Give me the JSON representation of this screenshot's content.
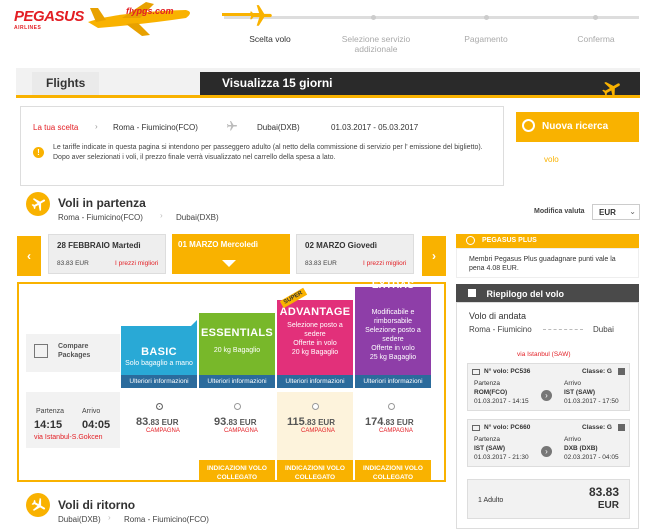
{
  "brand": {
    "logo": "PEGASUS",
    "logo_sub": "AIRLINES",
    "plane_text": "flypgs.com"
  },
  "steps": [
    {
      "label": "Scelta volo"
    },
    {
      "label": "Selezione servizio\naddizionale"
    },
    {
      "label": "Pagamento"
    },
    {
      "label": "Conferma"
    }
  ],
  "tabs": {
    "flights": "Flights",
    "view15": "Visualizza 15 giorni"
  },
  "choice": {
    "label": "La tua scelta",
    "from": "Roma - Fiumicino(FCO)",
    "to": "Dubai(DXB)",
    "dates": "01.03.2017 - 05.03.2017",
    "notice": "Le tariffe indicate in questa pagina si intendono per passeggero adulto (al netto della commissione di servizio per l' emissione del biglietto). Dopo aver selezionati i voli, il prezzo finale verrà visualizzato nel carrello della spesa a lato.",
    "new_search": "Nuova ricerca",
    "new_search_sub": "volo"
  },
  "outbound": {
    "title": "Voli in partenza",
    "route_from": "Roma - Fiumicino(FCO)",
    "route_to": "Dubai(DXB)",
    "currency_label": "Modifica valuta",
    "currency": "EUR"
  },
  "days": [
    {
      "title": "28 FEBBRAIO Martedì",
      "price": "83.83 EUR",
      "link": "I prezzi migliori"
    },
    {
      "title": "01 MARZO Mercoledì"
    },
    {
      "title": "02 MARZO Giovedì",
      "price": "83.83 EUR",
      "link": "I prezzi migliori"
    }
  ],
  "compare": {
    "label": "Compare\nPackages"
  },
  "fares": [
    {
      "name": "BASIC",
      "desc": "Solo bagaglio a mano",
      "more": "Ulteriori informazioni",
      "price_int": "83",
      "price_dec": ".83 EUR",
      "campaign": "CAMPAGNA",
      "connect": "",
      "color": "#29a9d6"
    },
    {
      "name": "ESSENTIALS",
      "desc": "20 kg Bagaglio",
      "more": "Ulteriori informazioni",
      "price_int": "93",
      "price_dec": ".83 EUR",
      "campaign": "CAMPAGNA",
      "connect": "INDICAZIONI VOLO\nCOLLEGATO",
      "color": "#78b82a"
    },
    {
      "name": "ADVANTAGE",
      "desc": "Selezione posto a sedere\nOfferte in volo\n20 kg Bagaglio",
      "more": "Ulteriori informazioni",
      "price_int": "115",
      "price_dec": ".83 EUR",
      "campaign": "CAMPAGNA",
      "connect": "INDICAZIONI VOLO\nCOLLEGATO",
      "color": "#e2307a",
      "badge": "SUPER"
    },
    {
      "name": "EXTRAS",
      "desc": "Modificabile e rimborsabile\nSelezione posto a sedere\nOfferte in volo\n25 kg Bagaglio",
      "more": "Ulteriori informazioni",
      "price_int": "174",
      "price_dec": ".83 EUR",
      "campaign": "CAMPAGNA",
      "connect": "INDICAZIONI VOLO\nCOLLEGATO",
      "color": "#8e3ea8"
    }
  ],
  "flight": {
    "dep_label": "Partenza",
    "arr_label": "Arrivo",
    "dep_time": "14:15",
    "arr_time": "04:05",
    "via": "via Istanbul-S.Gokcen"
  },
  "return": {
    "title": "Voli di ritorno",
    "route_from": "Dubai(DXB)",
    "route_to": "Roma - Fiumicino(FCO)"
  },
  "plus": {
    "title": "PEGASUS PLUS",
    "text": "Membri Pegasus Plus guadagnare punti vale la pena 4.08 EUR."
  },
  "summary": {
    "title": "Riepilogo del volo",
    "section": "Volo di andata",
    "from": "Roma - Fiumicino",
    "to": "Dubai",
    "via": "via Istanbul (SAW)",
    "legs": [
      {
        "flight_label": "N° volo: PC536",
        "class_label": "Classe: G",
        "dep_label": "Partenza",
        "dep_airport": "ROM(FCO)",
        "dep_date": "01.03.2017 - 14:15",
        "arr_label": "Arrivo",
        "arr_airport": "IST (SAW)",
        "arr_date": "01.03.2017 - 17:50"
      },
      {
        "flight_label": "N° volo: PC660",
        "class_label": "Classe: G",
        "dep_label": "Partenza",
        "dep_airport": "IST (SAW)",
        "dep_date": "01.03.2017 - 21:30",
        "arr_label": "Arrivo",
        "arr_airport": "DXB (DXB)",
        "arr_date": "02.03.2017 - 04:05"
      }
    ],
    "pax": "1 Adulto",
    "total": "83.83",
    "total_cur": "EUR"
  }
}
